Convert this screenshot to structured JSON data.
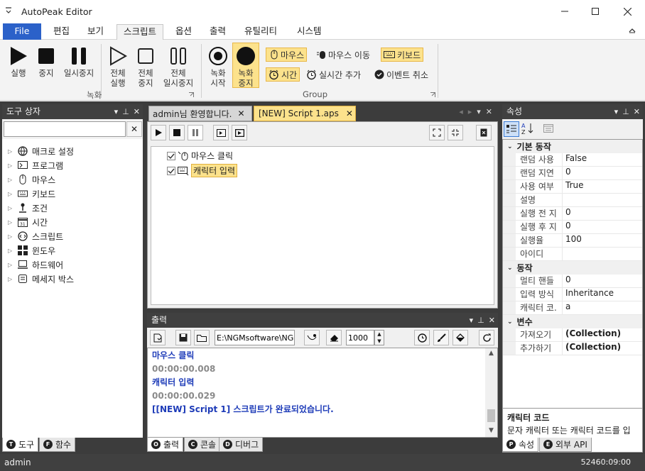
{
  "app": {
    "title": "AutoPeak Editor"
  },
  "ribbon_tabs": [
    "File",
    "편집",
    "보기",
    "스크립트",
    "옵션",
    "출력",
    "유틸리티",
    "시스템"
  ],
  "ribbon": {
    "run": "실행",
    "stop": "중지",
    "pause": "일시중지",
    "all_run": [
      "전체",
      "실행"
    ],
    "all_stop": [
      "전체",
      "중지"
    ],
    "all_pause": [
      "전체",
      "일시중지"
    ],
    "record_start": [
      "녹화",
      "시작"
    ],
    "record_stop": [
      "녹화",
      "중지"
    ],
    "mouse": "마우스",
    "mouse_move": "마우스 이동",
    "keyboard": "키보드",
    "time": "시간",
    "realtime_add": "실시간 추가",
    "event_cancel": "이벤트 취소",
    "group_record": "녹화",
    "group_group": "Group"
  },
  "toolbox": {
    "title": "도구 상자",
    "items": [
      "매크로 설정",
      "프로그램",
      "마우스",
      "키보드",
      "조건",
      "시간",
      "스크립트",
      "윈도우",
      "하드웨어",
      "메세지 박스"
    ],
    "tabs": [
      "도구",
      "함수"
    ]
  },
  "editor": {
    "tabs": [
      "admin님 환영합니다.",
      "[NEW] Script 1.aps"
    ],
    "nodes": [
      "마우스 클릭",
      "캐릭터 입력"
    ]
  },
  "output": {
    "title": "출력",
    "path": "E:\\NGMsoftware\\NG",
    "count": "1000",
    "lines": [
      {
        "text": "마우스 클릭",
        "kind": "action"
      },
      {
        "text": "00:00:00.008",
        "kind": "time"
      },
      {
        "text": "캐릭터 입력",
        "kind": "action"
      },
      {
        "text": "00:00:00.029",
        "kind": "time"
      },
      {
        "text": "[[NEW] Script 1] 스크립트가 완료되었습니다.",
        "kind": "action"
      }
    ],
    "tabs": [
      "출력",
      "콘솔",
      "디버그"
    ]
  },
  "properties": {
    "title": "속성",
    "categories": [
      {
        "name": "기본 동작",
        "rows": [
          {
            "key": "랜덤 사용",
            "value": "False"
          },
          {
            "key": "랜덤 지연",
            "value": "0"
          },
          {
            "key": "사용 여부",
            "value": "True"
          },
          {
            "key": "설명",
            "value": ""
          },
          {
            "key": "실행 전 지",
            "value": "0"
          },
          {
            "key": "실행 후 지",
            "value": "0"
          },
          {
            "key": "실행율",
            "value": "100"
          },
          {
            "key": "아이디",
            "value": ""
          }
        ]
      },
      {
        "name": "동작",
        "rows": [
          {
            "key": "멀티 핸들",
            "value": "0"
          },
          {
            "key": "입력 방식",
            "value": "Inheritance"
          },
          {
            "key": "캐릭터 코.",
            "value": "a"
          }
        ]
      },
      {
        "name": "변수",
        "rows": [
          {
            "key": "가져오기",
            "value": "(Collection)"
          },
          {
            "key": "추가하기",
            "value": "(Collection)"
          }
        ]
      }
    ],
    "desc_title": "캐릭터 코드",
    "desc_text": "문자 캐릭터 또는 캐릭터 코드를 입력하세요.",
    "tabs": [
      "속성",
      "외부 API"
    ]
  },
  "status": {
    "user": "admin",
    "right": "52460:09:00"
  },
  "colors": {
    "accent": "#2b61c9",
    "highlight": "#fce28c",
    "pane_header": "#404040",
    "output_blue": "#1d3bb8"
  }
}
